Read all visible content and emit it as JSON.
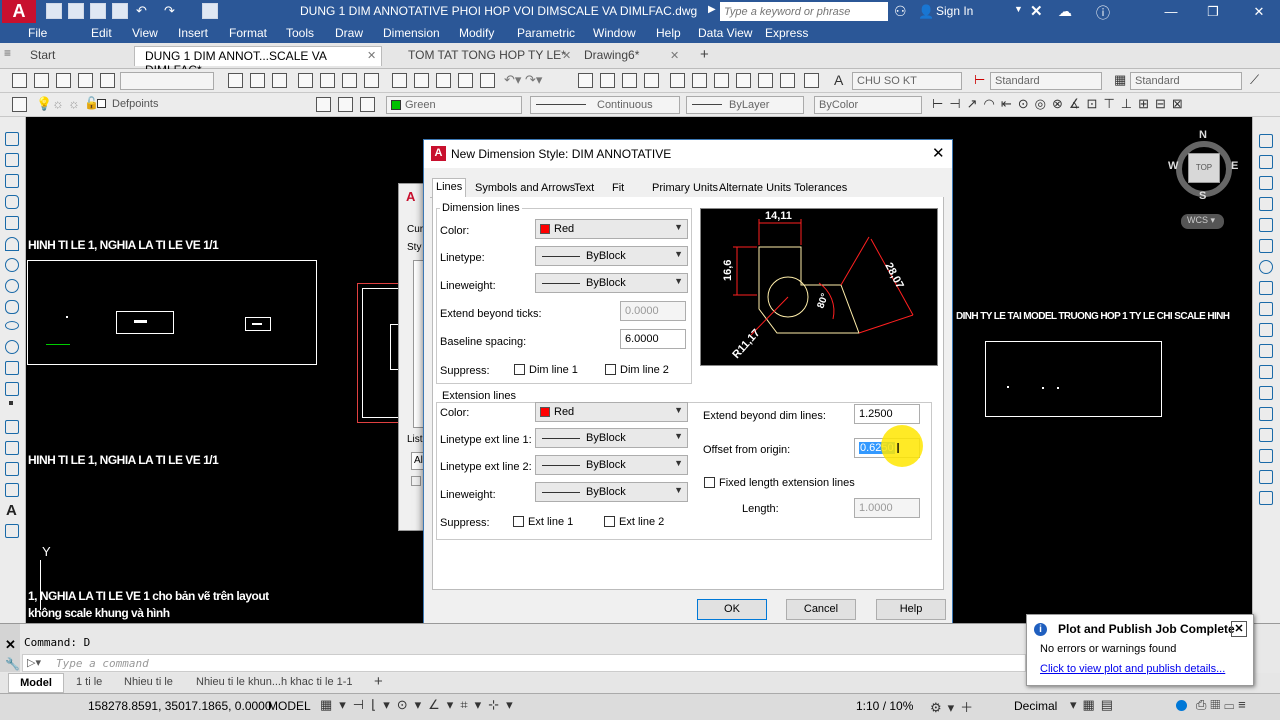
{
  "app": {
    "title": "DUNG 1 DIM ANNOTATIVE PHOI HOP VOI DIMSCALE VA DIMLFAC.dwg",
    "logo": "A",
    "search_placeholder": "Type a keyword or phrase",
    "signin": "Sign In"
  },
  "menu": [
    "File",
    "Edit",
    "View",
    "Insert",
    "Format",
    "Tools",
    "Draw",
    "Dimension",
    "Modify",
    "Parametric",
    "Window",
    "Help",
    "Data View",
    "Express"
  ],
  "doc_tabs": [
    "Start",
    "DUNG 1 DIM ANNOT...SCALE VA DIMLFAC*",
    "TOM TAT TONG HOP TY LE*",
    "Drawing6*"
  ],
  "toolbar": {
    "text_style": "CHU SO KT",
    "dim_style": "Standard",
    "table_style": "Standard",
    "layer": "Defpoints",
    "color": "Green",
    "linetype": "Continuous",
    "lineweight": "ByLayer",
    "plotstyle": "ByColor"
  },
  "viewcube": {
    "n": "N",
    "s": "S",
    "e": "E",
    "w": "W",
    "top": "TOP",
    "wcs": "WCS"
  },
  "drawing": {
    "texts": [
      "HINH TI LE 1, NGHIA LA TI LE VE 1/1",
      "HINH TI LE 1, NGHIA LA TI LE VE 1/1",
      "1, NGHIA LA TI LE VE 1 cho bản vẽ trên layout",
      "không scale khung và hình",
      "DINH TY LE TAI MODEL TRUONG HOP 1 TY LE CHI SCALE HINH"
    ],
    "ucs": "Y"
  },
  "behind_dialog": {
    "icon": "A",
    "cur": "Cur",
    "sty": "Sty",
    "list": "List",
    "all": "All"
  },
  "dialog": {
    "title": "New Dimension Style: DIM ANNOTATIVE",
    "tabs": [
      "Lines",
      "Symbols and Arrows",
      "Text",
      "Fit",
      "Primary Units",
      "Alternate Units",
      "Tolerances"
    ],
    "dim_lines": {
      "group": "Dimension lines",
      "color_label": "Color:",
      "color": "Red",
      "color_hex": "#ff0000",
      "linetype_label": "Linetype:",
      "linetype": "ByBlock",
      "lineweight_label": "Lineweight:",
      "lineweight": "ByBlock",
      "extend_label": "Extend beyond ticks:",
      "extend": "0.0000",
      "baseline_label": "Baseline spacing:",
      "baseline": "6.0000",
      "suppress_label": "Suppress:",
      "dim1": "Dim line 1",
      "dim2": "Dim line 2"
    },
    "ext_lines": {
      "group": "Extension lines",
      "color_label": "Color:",
      "color": "Red",
      "lt1_label": "Linetype ext line 1:",
      "lt1": "ByBlock",
      "lt2_label": "Linetype ext line 2:",
      "lt2": "ByBlock",
      "lw_label": "Lineweight:",
      "lw": "ByBlock",
      "suppress_label": "Suppress:",
      "ext1": "Ext line 1",
      "ext2": "Ext line 2"
    },
    "right": {
      "extend_label": "Extend beyond dim lines:",
      "extend": "1.2500",
      "offset_label": "Offset from origin:",
      "offset": "0.6250",
      "fixed_label": "Fixed length extension lines",
      "length_label": "Length:",
      "length": "1.0000"
    },
    "preview": {
      "d1": "14,11",
      "d2": "16,6",
      "d3": "28,07",
      "angle": "80°",
      "radius": "R11,17"
    },
    "buttons": {
      "ok": "OK",
      "cancel": "Cancel",
      "help": "Help"
    }
  },
  "command": {
    "history": "Command: D",
    "placeholder": "Type a command"
  },
  "layout_tabs": [
    "Model",
    "1 ti le",
    "Nhieu ti le",
    "Nhieu ti le khun...h khac ti le 1-1"
  ],
  "status": {
    "coords": "158278.8591, 35017.1865, 0.0000",
    "space": "MODEL",
    "scale": "1:10 / 10%",
    "units": "Decimal"
  },
  "notification": {
    "title": "Plot and Publish Job Complete",
    "message": "No errors or warnings found",
    "link": "Click to view plot and publish details..."
  }
}
